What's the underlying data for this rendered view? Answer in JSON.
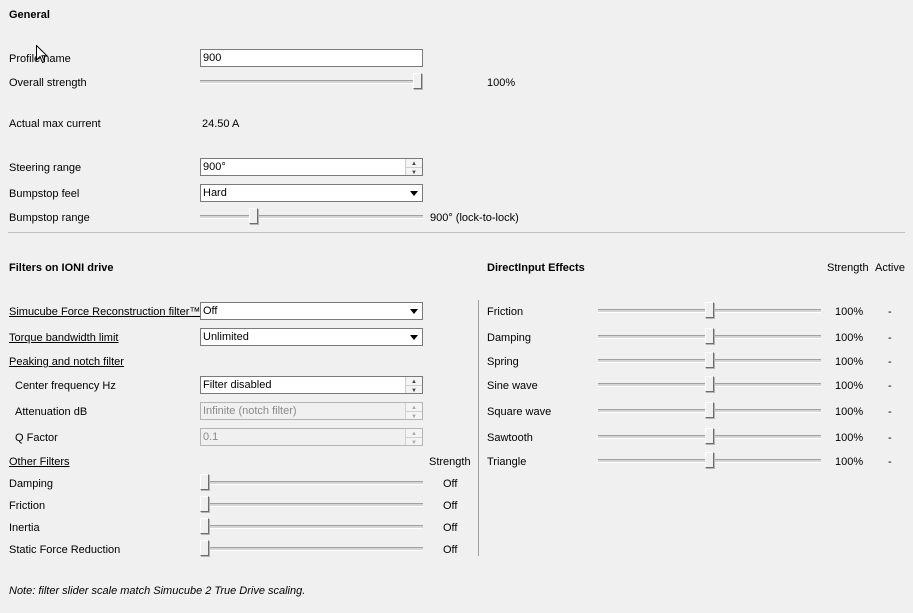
{
  "general": {
    "title": "General",
    "profile_name_label": "Profile name",
    "profile_name_value": "900",
    "overall_strength_label": "Overall strength",
    "overall_strength_value": "100%",
    "overall_strength_level": 1.0,
    "actual_max_current_label": "Actual max current",
    "actual_max_current_value": "24.50 A",
    "steering_range_label": "Steering range",
    "steering_range_value": "900°",
    "bumpstop_feel_label": "Bumpstop feel",
    "bumpstop_feel_value": "Hard",
    "bumpstop_range_label": "Bumpstop range",
    "bumpstop_range_value": "900° (lock-to-lock)",
    "bumpstop_range_level": 0.23
  },
  "filters": {
    "title": "Filters on IONI drive",
    "sfr_label": "Simucube Force Reconstruction filter™",
    "sfr_value": "Off",
    "torque_bw_label": "Torque bandwidth limit",
    "torque_bw_value": "Unlimited",
    "peaking_label": "Peaking and notch filter",
    "center_freq_label": "Center frequency Hz",
    "center_freq_value": "Filter disabled",
    "attenuation_label": "Attenuation dB",
    "attenuation_value": "Infinite (notch filter)",
    "q_factor_label": "Q Factor",
    "q_factor_value": "0.1",
    "other_filters_label": "Other Filters",
    "strength_header": "Strength",
    "other": [
      {
        "label": "Damping",
        "value": "Off",
        "level": 0
      },
      {
        "label": "Friction",
        "value": "Off",
        "level": 0
      },
      {
        "label": "Inertia",
        "value": "Off",
        "level": 0
      },
      {
        "label": "Static Force Reduction",
        "value": "Off",
        "level": 0
      }
    ]
  },
  "directinput": {
    "title": "DirectInput Effects",
    "strength_header": "Strength",
    "active_header": "Active",
    "effects": [
      {
        "label": "Friction",
        "value": "100%",
        "active": "-",
        "level": 0.5
      },
      {
        "label": "Damping",
        "value": "100%",
        "active": "-",
        "level": 0.5
      },
      {
        "label": "Spring",
        "value": "100%",
        "active": "-",
        "level": 0.5
      },
      {
        "label": "Sine wave",
        "value": "100%",
        "active": "-",
        "level": 0.5
      },
      {
        "label": "Square wave",
        "value": "100%",
        "active": "-",
        "level": 0.5
      },
      {
        "label": "Sawtooth",
        "value": "100%",
        "active": "-",
        "level": 0.5
      },
      {
        "label": "Triangle",
        "value": "100%",
        "active": "-",
        "level": 0.5
      }
    ]
  },
  "note": "Note: filter slider scale match Simucube 2 True Drive scaling.",
  "icons": {
    "dropdown": "chevron-down-icon",
    "spin_up": "spin-up-icon",
    "spin_down": "spin-down-icon"
  }
}
